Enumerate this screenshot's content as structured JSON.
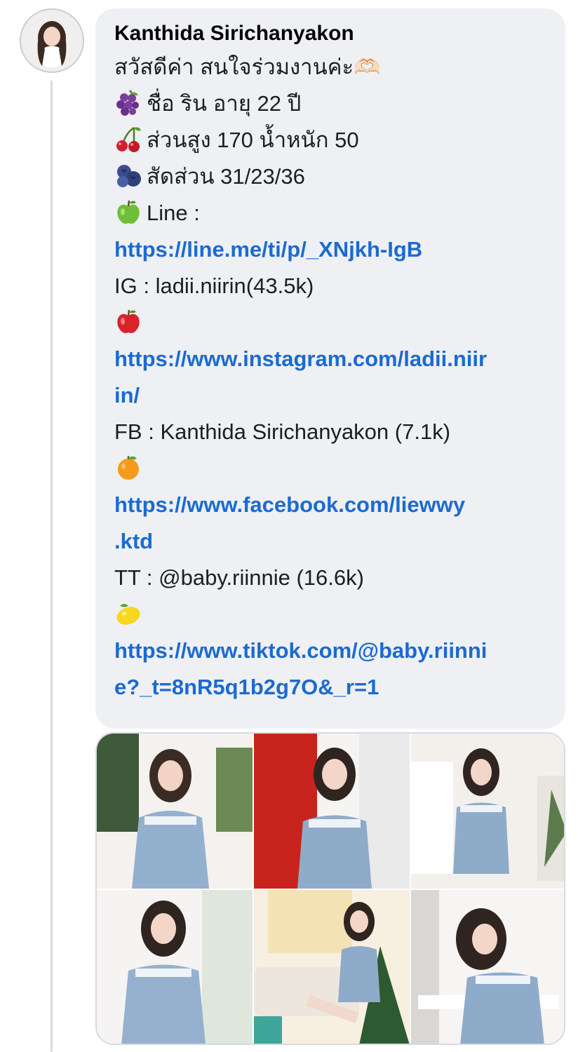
{
  "comment": {
    "author": "Kanthida Sirichanyakon",
    "lines": [
      {
        "type": "text",
        "text": "สวัสดีค่า สนใจร่วมงานค่ะ🫶🏻"
      },
      {
        "type": "text",
        "icon": "grapes-icon",
        "text": "ชื่อ  ริน อายุ 22 ปี"
      },
      {
        "type": "text",
        "icon": "cherries-icon",
        "text": "ส่วนสูง 170 น้ำหนัก 50"
      },
      {
        "type": "text",
        "icon": "blueberries-icon",
        "text": "สัดส่วน 31/23/36"
      },
      {
        "type": "text",
        "icon": "green-apple-icon",
        "text": "Line :"
      },
      {
        "type": "link",
        "text": "https://line.me/ti/p/_XNjkh-IgB"
      },
      {
        "type": "text",
        "text": "IG : ladii.niirin(43.5k)"
      },
      {
        "type": "icon",
        "icon": "red-apple-icon"
      },
      {
        "type": "link",
        "text": "https://www.instagram.com/ladii.niir"
      },
      {
        "type": "link",
        "text": "in/"
      },
      {
        "type": "text",
        "text": "FB : Kanthida Sirichanyakon  (7.1k)"
      },
      {
        "type": "icon",
        "icon": "tangerine-icon"
      },
      {
        "type": "link",
        "text": "https://www.facebook.com/liewwy"
      },
      {
        "type": "link",
        "text": ".ktd"
      },
      {
        "type": "text",
        "text": "TT : @baby.riinnie (16.6k)"
      },
      {
        "type": "icon",
        "icon": "lemon-icon"
      },
      {
        "type": "link",
        "text": "https://www.tiktok.com/@baby.riinni"
      },
      {
        "type": "link",
        "text": "e?_t=8nR5q1b2g7O&_r=1"
      }
    ]
  },
  "photos": [
    {
      "name": "photo-1"
    },
    {
      "name": "photo-2"
    },
    {
      "name": "photo-3"
    },
    {
      "name": "photo-4"
    },
    {
      "name": "photo-5"
    },
    {
      "name": "photo-6"
    }
  ],
  "colors": {
    "bubble": "#eef0f3",
    "link": "#1c6ad1",
    "text": "#1c1e21"
  }
}
